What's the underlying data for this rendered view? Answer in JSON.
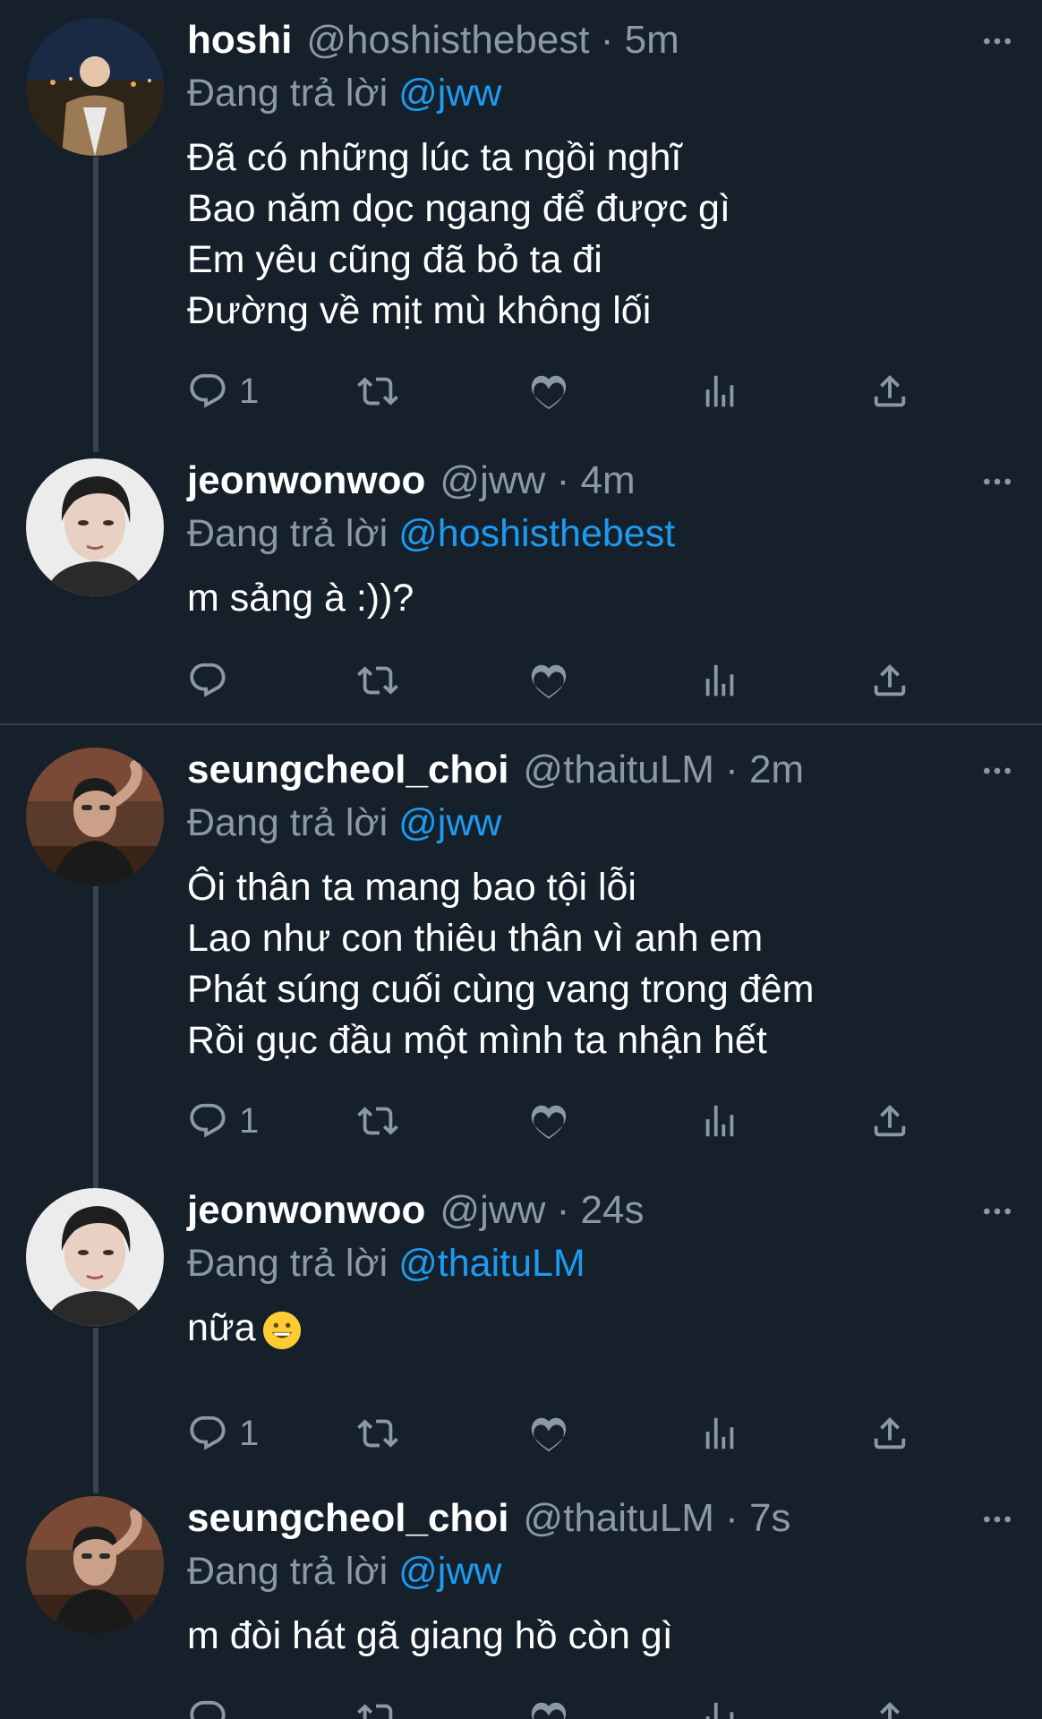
{
  "colors": {
    "background": "#15202b",
    "text_primary": "#ffffff",
    "text_secondary": "#8b98a5",
    "mention": "#1d9bf0",
    "divider": "#38444d"
  },
  "tweets": [
    {
      "name": "hoshi",
      "handle_time": "@hoshisthebest · 5m",
      "replying_prefix": "Đang trả lời",
      "replying_to": "@jww",
      "text": "Đã có những lúc ta ngồi nghĩ\nBao năm dọc ngang để được gì\nEm yêu cũng đã bỏ ta đi\nĐường về mịt mù không lối",
      "reply_count": "1",
      "avatar_icon": "avatar-hoshi"
    },
    {
      "name": "jeonwonwoo",
      "handle_time": "@jww · 4m",
      "replying_prefix": "Đang trả lời",
      "replying_to": "@hoshisthebest",
      "text": "m sảng à :))?",
      "reply_count": "",
      "avatar_icon": "avatar-jeonwonwoo"
    },
    {
      "name": "seungcheol_choi",
      "handle_time": "@thaituLM · 2m",
      "replying_prefix": "Đang trả lời",
      "replying_to": "@jww",
      "text": "Ôi thân ta mang bao tội lỗi\nLao như con thiêu thân vì anh em\nPhát súng cuối cùng vang trong đêm\nRồi gục đầu một mình ta nhận hết",
      "reply_count": "1",
      "avatar_icon": "avatar-seungcheol"
    },
    {
      "name": "jeonwonwoo",
      "handle_time": "@jww · 24s",
      "replying_prefix": "Đang trả lời",
      "replying_to": "@thaituLM",
      "text": "nữa",
      "emoji": "grinning-face-emoji",
      "reply_count": "1",
      "avatar_icon": "avatar-jeonwonwoo"
    },
    {
      "name": "seungcheol_choi",
      "handle_time": "@thaituLM · 7s",
      "replying_prefix": "Đang trả lời",
      "replying_to": "@jww",
      "text": "m đòi hát gã giang hồ còn gì",
      "reply_count": "",
      "avatar_icon": "avatar-seungcheol"
    }
  ],
  "action_icons": [
    "reply-icon",
    "retweet-icon",
    "like-icon",
    "analytics-icon",
    "share-icon"
  ]
}
